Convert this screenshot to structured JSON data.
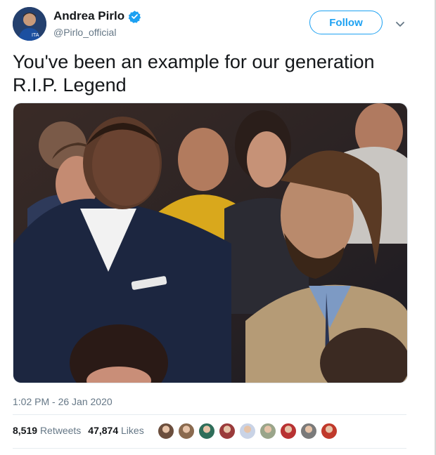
{
  "author": {
    "display_name": "Andrea Pirlo",
    "handle": "@Pirlo_official",
    "verified": true,
    "avatar_icon": "user-avatar"
  },
  "follow_button": {
    "label": "Follow"
  },
  "menu_icon": "chevron-down-icon",
  "tweet": {
    "line1": "You've been an example for our generation",
    "line2": "R.I.P. Legend"
  },
  "media": {
    "type": "photo"
  },
  "meta": {
    "timestamp": "1:02 PM - 26 Jan 2020"
  },
  "stats": {
    "retweets_count": "8,519",
    "retweets_label": "Retweets",
    "likes_count": "47,874",
    "likes_label": "Likes"
  },
  "liker_avatars": [
    {
      "color": "#6b4e3d"
    },
    {
      "color": "#8a6a4f"
    },
    {
      "color": "#2f6e5a"
    },
    {
      "color": "#9a3b3b"
    },
    {
      "color": "#c9d3e6"
    },
    {
      "color": "#9aa58a"
    },
    {
      "color": "#b83232"
    },
    {
      "color": "#7a7a7a"
    },
    {
      "color": "#c0392b"
    }
  ],
  "colors": {
    "accent": "#1da1f2",
    "text": "#14171a",
    "muted": "#657786"
  }
}
